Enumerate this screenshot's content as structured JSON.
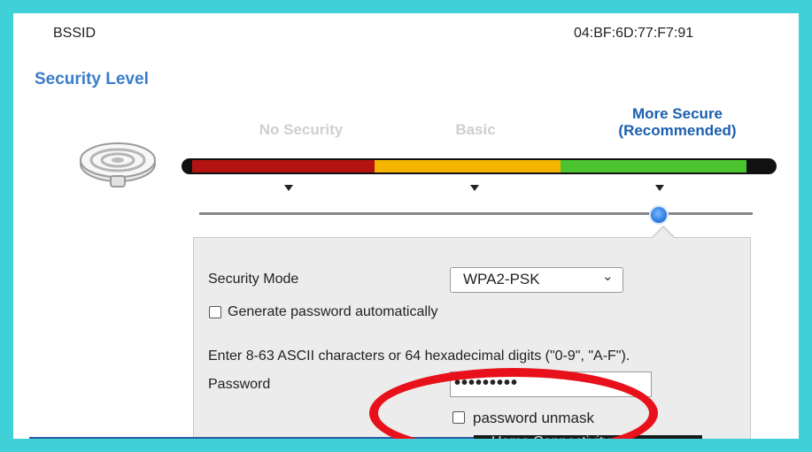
{
  "network": {
    "bssid_label": "BSSID",
    "bssid_value": "04:BF:6D:77:F7:91"
  },
  "security_level": {
    "title": "Security Level",
    "levels": [
      {
        "label": "No Security",
        "active": false
      },
      {
        "label": "Basic",
        "active": false
      },
      {
        "label_line1": "More Secure",
        "label_line2": "(Recommended)",
        "active": true
      }
    ],
    "selected_level_index": 2,
    "colors": {
      "no_security": "#b31412",
      "basic": "#f5b400",
      "more_secure": "#4cc42f",
      "active_label": "#1b5fae",
      "inactive_label": "#cfcfcf"
    }
  },
  "settings": {
    "security_mode_label": "Security Mode",
    "security_mode_value": "WPA2-PSK",
    "generate_password_label": "Generate password automatically",
    "generate_password_checked": false,
    "hint_text": "Enter 8-63 ASCII characters or 64 hexadecimal digits (\"0-9\", \"A-F\").",
    "password_label": "Password",
    "password_masked": "•••••••••",
    "password_unmask_label": "password unmask",
    "password_unmask_checked": false
  },
  "footer": {
    "button_text": "Home Connectivity"
  },
  "icons": {
    "router": "router-icon",
    "dropdown": "chevron-down-icon"
  },
  "annotation": {
    "highlight_color": "#e8111b"
  },
  "frame_color": "#3fd0d8"
}
